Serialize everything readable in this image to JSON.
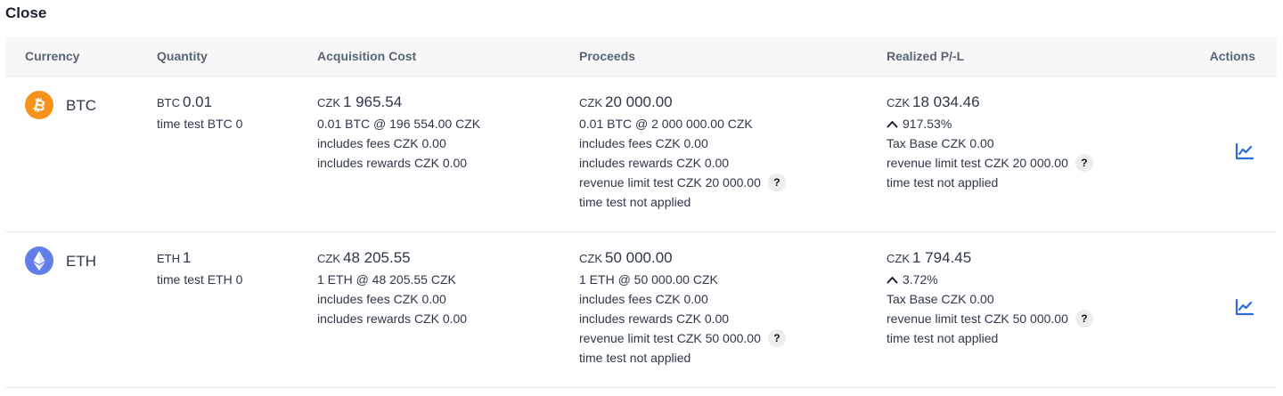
{
  "section": {
    "title": "Close"
  },
  "headers": {
    "currency": "Currency",
    "quantity": "Quantity",
    "acquisition_cost": "Acquisition Cost",
    "proceeds": "Proceeds",
    "realized_pl": "Realized P/-L",
    "actions": "Actions"
  },
  "rows": [
    {
      "currency": {
        "symbol": "BTC",
        "icon": "bitcoin-icon",
        "color": "#f7931a"
      },
      "quantity": {
        "unit": "BTC",
        "value": "0.01",
        "time_test": "time test BTC 0"
      },
      "acquisition": {
        "unit": "CZK",
        "value": "1 965.54",
        "detail": "0.01 BTC @ 196 554.00 CZK",
        "fees": "includes fees CZK 0.00",
        "rewards": "includes rewards CZK 0.00"
      },
      "proceeds": {
        "unit": "CZK",
        "value": "20 000.00",
        "detail": "0.01 BTC @ 2 000 000.00 CZK",
        "fees": "includes fees CZK 0.00",
        "rewards": "includes rewards CZK 0.00",
        "revenue_limit": "revenue limit test CZK 20 000.00",
        "help": "?",
        "time_test": "time test not applied"
      },
      "realized": {
        "unit": "CZK",
        "value": "18 034.46",
        "percent": "917.53%",
        "tax_base": "Tax Base CZK 0.00",
        "revenue_limit": "revenue limit test CZK 20 000.00",
        "help": "?",
        "time_test": "time test not applied"
      }
    },
    {
      "currency": {
        "symbol": "ETH",
        "icon": "ethereum-icon",
        "color": "#627eea"
      },
      "quantity": {
        "unit": "ETH",
        "value": "1",
        "time_test": "time test ETH 0"
      },
      "acquisition": {
        "unit": "CZK",
        "value": "48 205.55",
        "detail": "1 ETH @ 48 205.55 CZK",
        "fees": "includes fees CZK 0.00",
        "rewards": "includes rewards CZK 0.00"
      },
      "proceeds": {
        "unit": "CZK",
        "value": "50 000.00",
        "detail": "1 ETH @ 50 000.00 CZK",
        "fees": "includes fees CZK 0.00",
        "rewards": "includes rewards CZK 0.00",
        "revenue_limit": "revenue limit test CZK 50 000.00",
        "help": "?",
        "time_test": "time test not applied"
      },
      "realized": {
        "unit": "CZK",
        "value": "1 794.45",
        "percent": "3.72%",
        "tax_base": "Tax Base CZK 0.00",
        "revenue_limit": "revenue limit test CZK 50 000.00",
        "help": "?",
        "time_test": "time test not applied"
      }
    }
  ],
  "colors": {
    "accent": "#2b6cd8",
    "header_bg": "#f7f7f8",
    "border": "#e6e8ec"
  }
}
